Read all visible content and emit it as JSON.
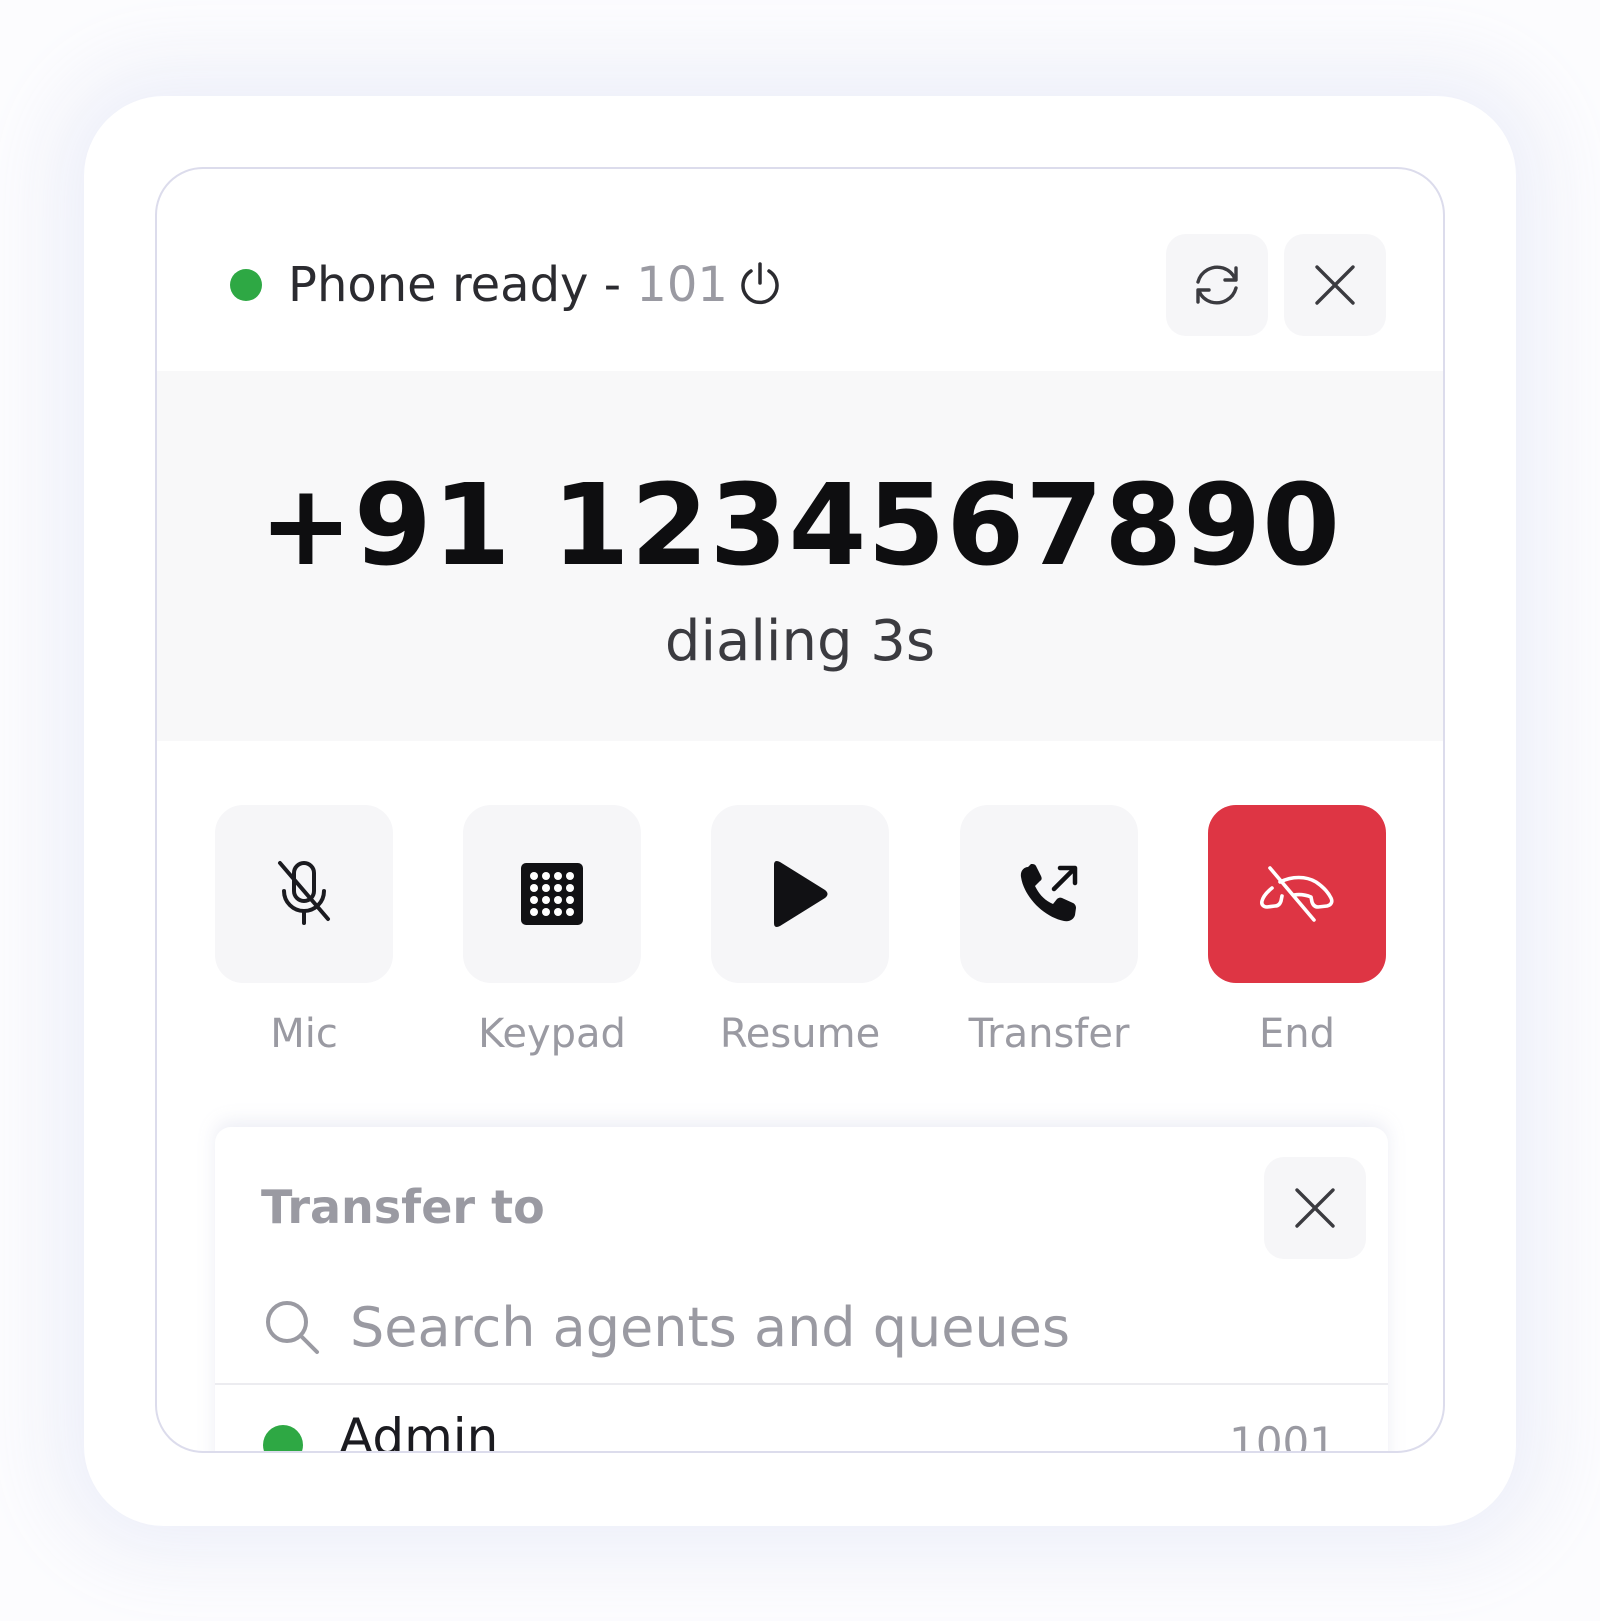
{
  "header": {
    "status_text": "Phone ready - ",
    "extension": "101",
    "status_color": "#2ea844",
    "icons": [
      "power-icon",
      "refresh-icon",
      "close-icon"
    ]
  },
  "call": {
    "number": "+91 1234567890",
    "status": "dialing 3s"
  },
  "controls": [
    {
      "label": "Mic",
      "icon": "mic-off-icon"
    },
    {
      "label": "Keypad",
      "icon": "keypad-icon"
    },
    {
      "label": "Resume",
      "icon": "play-icon"
    },
    {
      "label": "Transfer",
      "icon": "phone-transfer-icon"
    },
    {
      "label": "End",
      "icon": "hang-up-icon",
      "color": "#de3544"
    }
  ],
  "transfer": {
    "title": "Transfer to",
    "search_placeholder": "Search agents and queues",
    "agents": [
      {
        "name": "Admin",
        "extension": "1001",
        "status_color": "#2ea844"
      }
    ]
  }
}
